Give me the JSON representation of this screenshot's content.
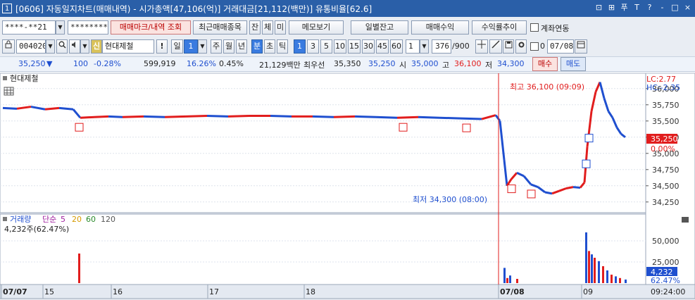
{
  "title": {
    "number": "1",
    "text": "[0606] 자동일지차트(매매내역) - 시가총액[47,106(억)] 거래대금[21,112(백만)] 유통비율[62.6]",
    "controls": [
      "⊡",
      "⊞",
      "푸",
      "T",
      "?",
      "-",
      "□",
      "×"
    ]
  },
  "toolbar1": {
    "account": "****-**21",
    "password": "********",
    "btn_trade_mark": "매매마크/내역 조회",
    "btn_recent": "최근매매종목",
    "btn_jan": "잔",
    "btn_che": "체",
    "btn_mi": "미",
    "btn_memo": "메모보기",
    "btn_daily_balance": "일별잔고",
    "btn_trade_profit": "매매수익",
    "btn_return_trend": "수익률추이",
    "link_account_label": "계좌연동"
  },
  "toolbar2": {
    "code": "004020",
    "stock_badge": "신",
    "stock_name": "현대제철",
    "btn_alert": "!",
    "period_label": "일",
    "period_value": "1",
    "periods": [
      "주",
      "월",
      "년",
      "분",
      "초",
      "틱"
    ],
    "minute_options": [
      "1",
      "3",
      "5",
      "10",
      "15",
      "30",
      "45",
      "60"
    ],
    "count_value": "1",
    "data_count": "376",
    "data_max": "/900",
    "check_label": "0",
    "date": "07/08"
  },
  "quote": {
    "price": "35,250",
    "change_arrow": "▼",
    "change": "100",
    "change_pct": "-0.28%",
    "volume": "599,919",
    "vol_ratio": "16.26%",
    "turnover": "0.45%",
    "amount": "21,129백만",
    "best_label": "최우선",
    "best_ask": "35,350",
    "best_bid": "35,250",
    "open_label": "시",
    "open": "35,000",
    "high_label": "고",
    "high": "36,100",
    "low_label": "저",
    "low": "34,300",
    "buy_label": "매수",
    "sell_label": "매도"
  },
  "chart_data": {
    "type": "line",
    "title": "현대제철",
    "price_axis_ticks": [
      "36,000",
      "35,750",
      "35,500",
      "35,250",
      "35,000",
      "34,750",
      "34,500",
      "34,250"
    ],
    "ylim": [
      34150,
      36150
    ],
    "last_price_label": "35,250",
    "last_change_label": "0.00%",
    "lc_label": "LC:2.77",
    "hc_label": "HC:-2.35",
    "high_annotation": "최고 36,100 (09:09)",
    "low_annotation": "최저 34,300 (08:00)",
    "x_labels": [
      "07/07",
      "15",
      "16",
      "17",
      "18",
      "07/08",
      "09"
    ],
    "time_label": "09:24:00",
    "price_series": [
      {
        "x": 0,
        "y": 35700
      },
      {
        "x": 20,
        "y": 35690
      },
      {
        "x": 40,
        "y": 35720
      },
      {
        "x": 60,
        "y": 35680
      },
      {
        "x": 80,
        "y": 35700
      },
      {
        "x": 100,
        "y": 35680
      },
      {
        "x": 110,
        "y": 35550
      },
      {
        "x": 130,
        "y": 35560
      },
      {
        "x": 150,
        "y": 35570
      },
      {
        "x": 170,
        "y": 35560
      },
      {
        "x": 200,
        "y": 35570
      },
      {
        "x": 230,
        "y": 35560
      },
      {
        "x": 260,
        "y": 35570
      },
      {
        "x": 290,
        "y": 35580
      },
      {
        "x": 320,
        "y": 35570
      },
      {
        "x": 350,
        "y": 35580
      },
      {
        "x": 380,
        "y": 35580
      },
      {
        "x": 410,
        "y": 35570
      },
      {
        "x": 440,
        "y": 35570
      },
      {
        "x": 470,
        "y": 35560
      },
      {
        "x": 500,
        "y": 35570
      },
      {
        "x": 530,
        "y": 35560
      },
      {
        "x": 560,
        "y": 35550
      },
      {
        "x": 590,
        "y": 35560
      },
      {
        "x": 620,
        "y": 35550
      },
      {
        "x": 650,
        "y": 35540
      },
      {
        "x": 680,
        "y": 35530
      },
      {
        "x": 700,
        "y": 35590
      },
      {
        "x": 706,
        "y": 35500
      },
      {
        "x": 712,
        "y": 34900
      },
      {
        "x": 716,
        "y": 34500
      },
      {
        "x": 722,
        "y": 34600
      },
      {
        "x": 730,
        "y": 34700
      },
      {
        "x": 740,
        "y": 34650
      },
      {
        "x": 750,
        "y": 34520
      },
      {
        "x": 760,
        "y": 34480
      },
      {
        "x": 770,
        "y": 34400
      },
      {
        "x": 780,
        "y": 34380
      },
      {
        "x": 790,
        "y": 34420
      },
      {
        "x": 800,
        "y": 34460
      },
      {
        "x": 810,
        "y": 34480
      },
      {
        "x": 820,
        "y": 34470
      },
      {
        "x": 826,
        "y": 34550
      },
      {
        "x": 830,
        "y": 35100
      },
      {
        "x": 836,
        "y": 35650
      },
      {
        "x": 842,
        "y": 35950
      },
      {
        "x": 848,
        "y": 36100
      },
      {
        "x": 854,
        "y": 35850
      },
      {
        "x": 860,
        "y": 35650
      },
      {
        "x": 866,
        "y": 35550
      },
      {
        "x": 872,
        "y": 35400
      },
      {
        "x": 878,
        "y": 35300
      },
      {
        "x": 884,
        "y": 35250
      }
    ],
    "volume_axis_ticks": [
      "50,000",
      "25,000"
    ],
    "volume_last_label": "4,232",
    "volume_pct_label": "62.47%",
    "volume_legend": [
      "거래량",
      "단순",
      "5",
      "20",
      "60",
      "120"
    ],
    "volume_subtitle": "4,232주(62.47%)",
    "volume_ylim": [
      0,
      60000
    ],
    "volume_series": [
      {
        "x": 108,
        "v": 35000
      },
      {
        "x": 712,
        "v": 18000
      },
      {
        "x": 716,
        "v": 6000
      },
      {
        "x": 720,
        "v": 9000
      },
      {
        "x": 730,
        "v": 5000
      },
      {
        "x": 828,
        "v": 60000
      },
      {
        "x": 832,
        "v": 38000
      },
      {
        "x": 836,
        "v": 34000
      },
      {
        "x": 840,
        "v": 30000
      },
      {
        "x": 846,
        "v": 26000
      },
      {
        "x": 852,
        "v": 20000
      },
      {
        "x": 858,
        "v": 15000
      },
      {
        "x": 864,
        "v": 10000
      },
      {
        "x": 870,
        "v": 8000
      },
      {
        "x": 876,
        "v": 6000
      },
      {
        "x": 884,
        "v": 4232
      }
    ],
    "buy_markers": [
      108,
      568,
      658,
      722,
      750
    ],
    "sell_markers": [
      832,
      828
    ],
    "grid": true
  },
  "colors": {
    "up": "#e11d1d",
    "down": "#1f4fcf",
    "titlebar": "#2a5fa8",
    "accent": "#3a7be0"
  },
  "icons": [
    "lock-icon",
    "search-icon",
    "speaker-icon",
    "gear-icon",
    "save-icon",
    "print-icon",
    "calendar-icon",
    "grid-icon"
  ]
}
